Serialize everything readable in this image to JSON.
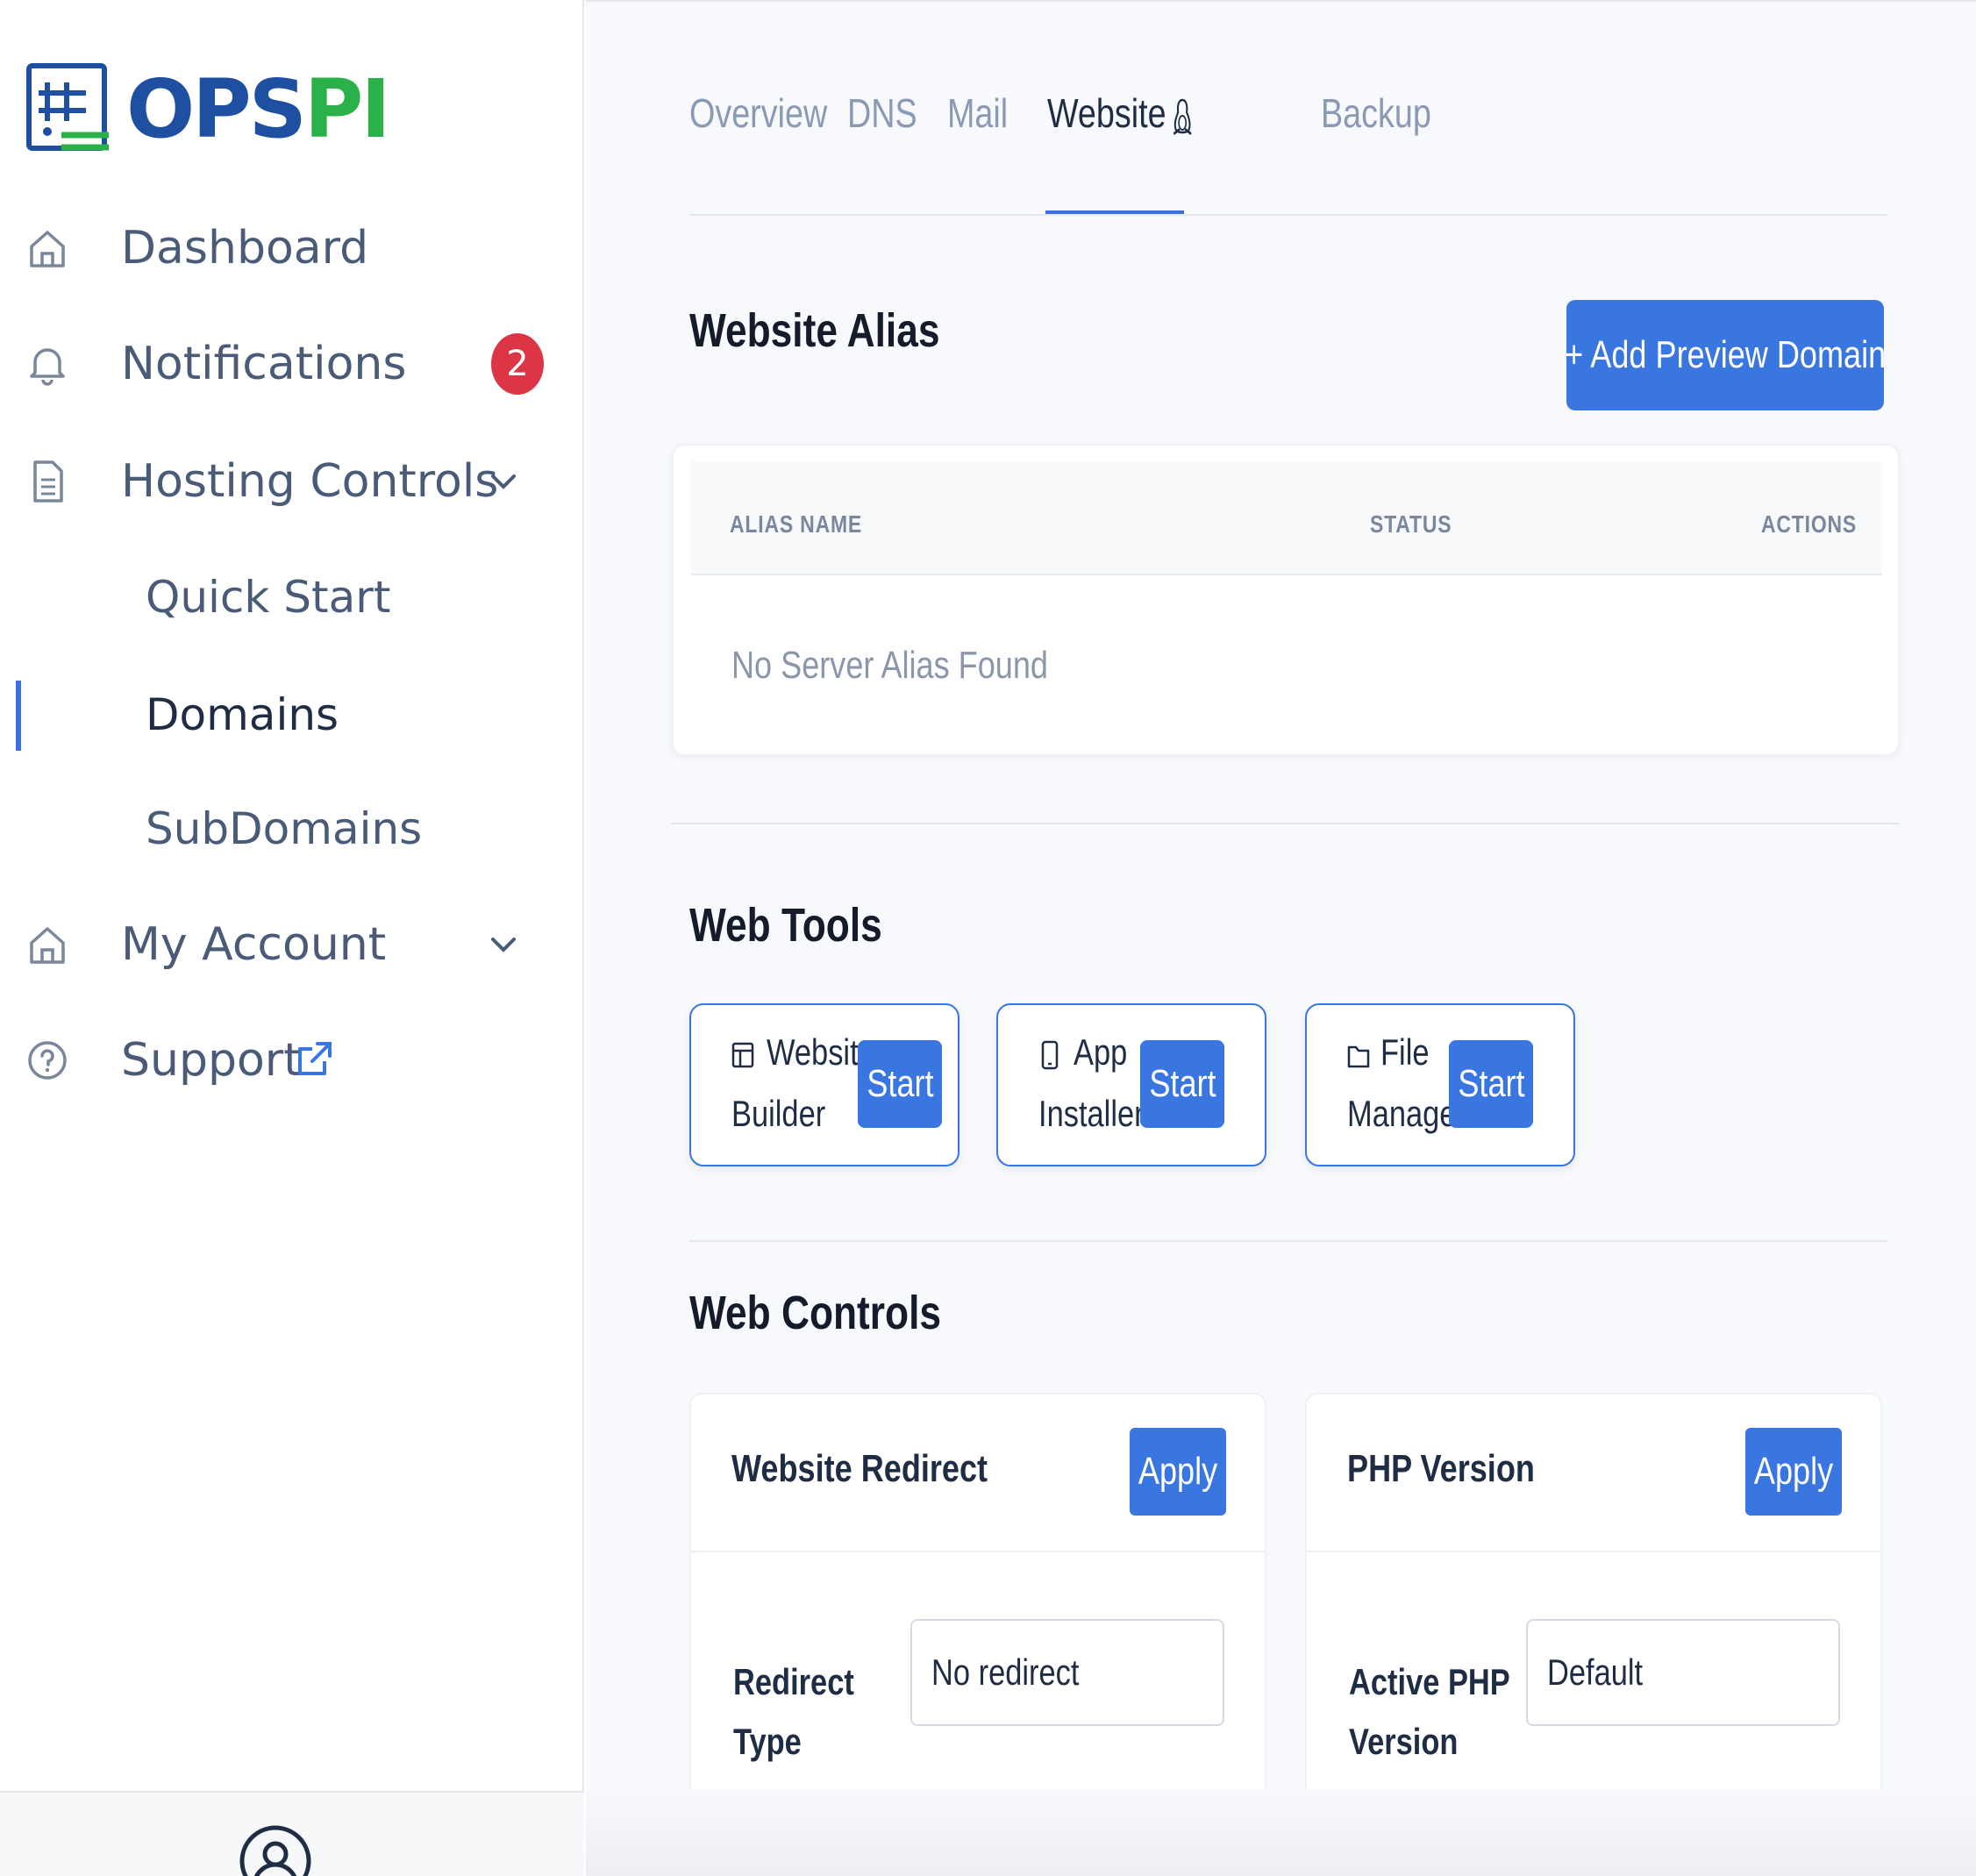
{
  "brand": {
    "ops": "OPS",
    "pi": "PI"
  },
  "sidebar": {
    "items": [
      {
        "label": "Dashboard",
        "icon": "home-icon"
      },
      {
        "label": "Notifications",
        "icon": "bell-icon",
        "badge": "2"
      },
      {
        "label": "Hosting Controls",
        "icon": "document-icon",
        "expanded": true,
        "children": [
          {
            "label": "Quick Start"
          },
          {
            "label": "Domains",
            "active": true
          },
          {
            "label": "SubDomains"
          }
        ]
      },
      {
        "label": "My Account",
        "icon": "home-icon"
      },
      {
        "label": "Support",
        "icon": "help-circle-icon",
        "external": true
      }
    ]
  },
  "tabs": [
    {
      "label": "Overview"
    },
    {
      "label": "DNS"
    },
    {
      "label": "Mail"
    },
    {
      "label": "Website",
      "active": true,
      "icon": "linux-icon"
    },
    {
      "label": "Backup"
    }
  ],
  "alias": {
    "title": "Website Alias",
    "add_button": "Add Preview Domain",
    "columns": [
      "ALIAS NAME",
      "STATUS",
      "ACTIONS"
    ],
    "empty": "No Server Alias Found"
  },
  "web_tools": {
    "title": "Web Tools",
    "tools": [
      {
        "line1": "Website",
        "line2": "Builder",
        "button": "Start",
        "icon": "layout-icon"
      },
      {
        "line1": "App",
        "line2": "Installer",
        "button": "Start",
        "icon": "mobile-icon"
      },
      {
        "line1": "File",
        "line2": "Manager",
        "button": "Start",
        "icon": "folder-icon"
      }
    ]
  },
  "web_controls": {
    "title": "Web Controls",
    "cards": [
      {
        "title": "Website Redirect",
        "button": "Apply",
        "field_label_1": "Redirect",
        "field_label_2": "Type",
        "value": "No redirect"
      },
      {
        "title": "PHP Version",
        "button": "Apply",
        "field_label_1": "Active PHP",
        "field_label_2": "Version",
        "value": "Default"
      }
    ]
  },
  "colors": {
    "accent": "#3a76e0",
    "brand_blue": "#1f4fa0",
    "brand_green": "#2bb14a",
    "badge": "#dc3545"
  }
}
